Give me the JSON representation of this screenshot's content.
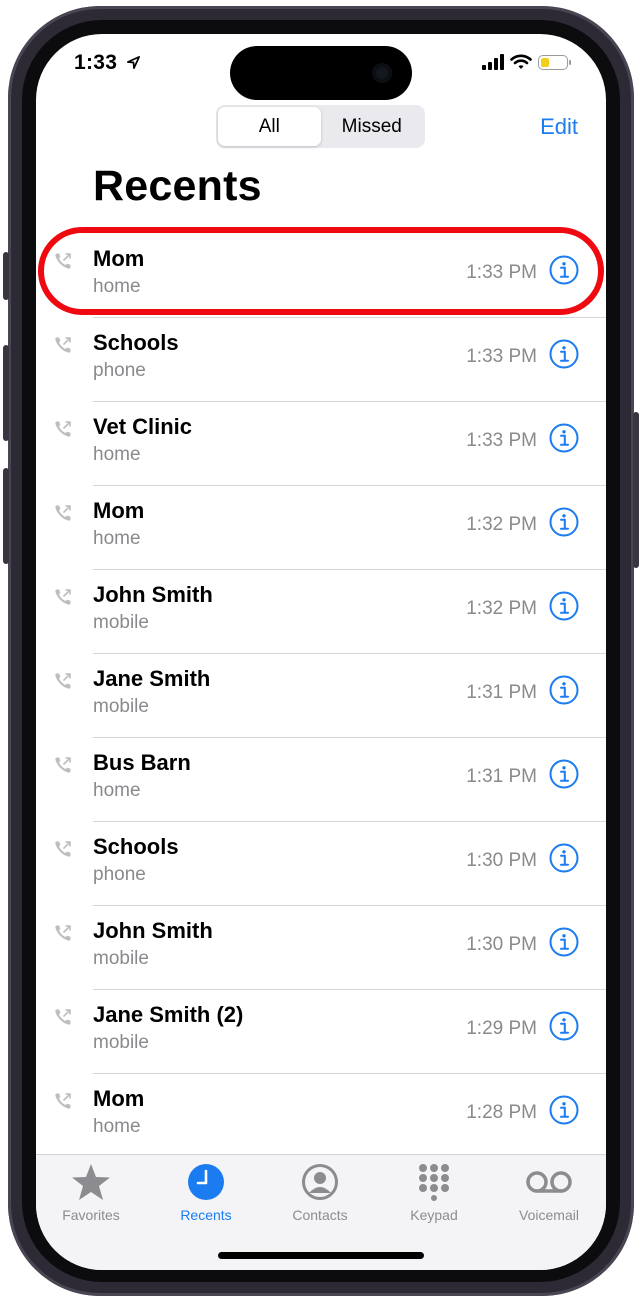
{
  "status_bar": {
    "time": "1:33",
    "location_icon": "location-arrow-icon",
    "signal_icon": "cellular-signal-icon",
    "wifi_icon": "wifi-icon",
    "battery_icon": "battery-icon",
    "battery_level": 0.35,
    "battery_color": "#f2cf1c"
  },
  "segmented_control": {
    "options": [
      "All",
      "Missed"
    ],
    "selected": "All"
  },
  "edit_label": "Edit",
  "page_title": "Recents",
  "colors": {
    "accent": "#1a7cf0",
    "highlight": "#ee0a10",
    "secondary_text": "#8a8a8e"
  },
  "calls": [
    {
      "name": "Mom",
      "type": "home",
      "time": "1:33 PM"
    },
    {
      "name": "Schools",
      "type": "phone",
      "time": "1:33 PM"
    },
    {
      "name": "Vet Clinic",
      "type": "home",
      "time": "1:33 PM"
    },
    {
      "name": "Mom",
      "type": "home",
      "time": "1:32 PM"
    },
    {
      "name": "John Smith",
      "type": "mobile",
      "time": "1:32 PM"
    },
    {
      "name": "Jane Smith",
      "type": "mobile",
      "time": "1:31 PM"
    },
    {
      "name": "Bus Barn",
      "type": "home",
      "time": "1:31 PM"
    },
    {
      "name": "Schools",
      "type": "phone",
      "time": "1:30 PM"
    },
    {
      "name": "John Smith",
      "type": "mobile",
      "time": "1:30 PM"
    },
    {
      "name": "Jane Smith (2)",
      "type": "mobile",
      "time": "1:29 PM"
    },
    {
      "name": "Mom",
      "type": "home",
      "time": "1:28 PM"
    }
  ],
  "row_icons": {
    "outgoing": "outgoing-call-icon",
    "info": "info-icon"
  },
  "tab_bar": {
    "active": "Recents",
    "tabs": [
      {
        "label": "Favorites",
        "icon": "star-icon"
      },
      {
        "label": "Recents",
        "icon": "clock-icon"
      },
      {
        "label": "Contacts",
        "icon": "person-circle-icon"
      },
      {
        "label": "Keypad",
        "icon": "keypad-icon"
      },
      {
        "label": "Voicemail",
        "icon": "voicemail-icon"
      }
    ]
  }
}
